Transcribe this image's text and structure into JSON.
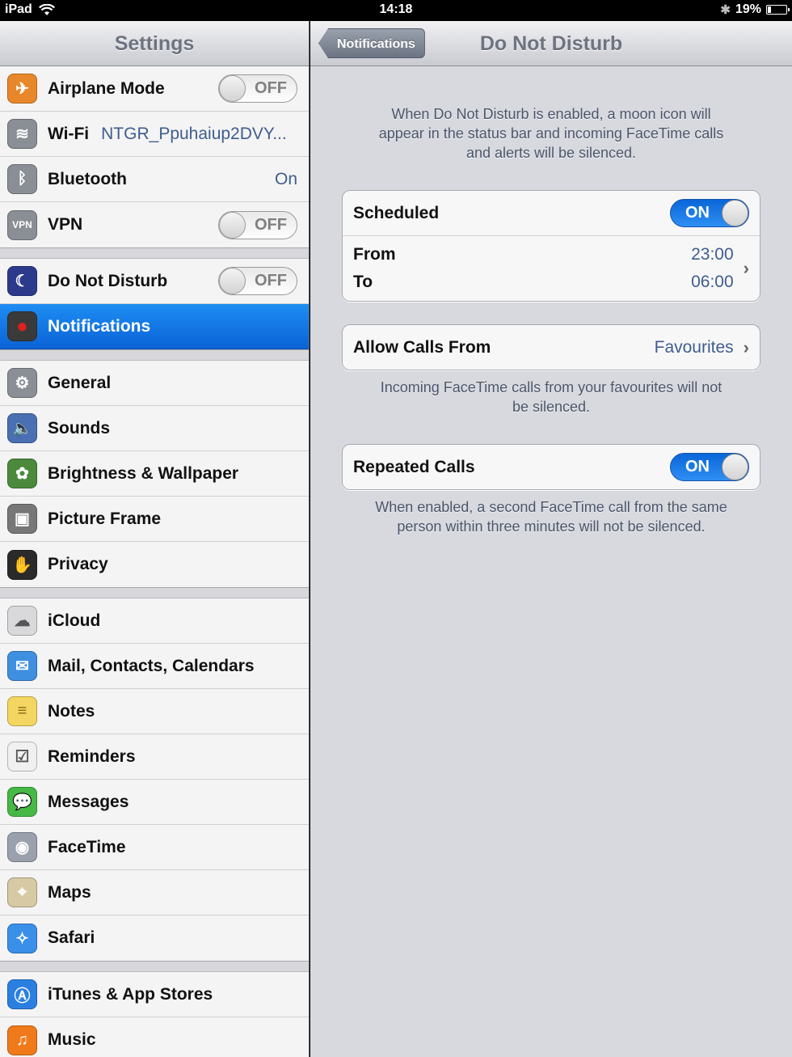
{
  "status_bar": {
    "device": "iPad",
    "time": "14:18",
    "battery_text": "19%",
    "battery_level": 0.19
  },
  "sidebar": {
    "title": "Settings",
    "groups": [
      [
        {
          "label": "Airplane Mode",
          "icon": "airplane-icon",
          "color": "#e8872a",
          "switch": "OFF"
        },
        {
          "label": "Wi-Fi",
          "icon": "wifi-icon",
          "color": "#8a8e95",
          "value": "NTGR_Ppuhaiup2DVY..."
        },
        {
          "label": "Bluetooth",
          "icon": "bluetooth-icon",
          "color": "#8a8e95",
          "value": "On"
        },
        {
          "label": "VPN",
          "icon": "vpn-icon",
          "color": "#8a8e95",
          "switch": "OFF"
        }
      ],
      [
        {
          "label": "Do Not Disturb",
          "icon": "moon-icon",
          "color": "#2c3a8c",
          "switch": "OFF"
        },
        {
          "label": "Notifications",
          "icon": "notifications-icon",
          "color": "#3a3a3a",
          "selected": true
        }
      ],
      [
        {
          "label": "General",
          "icon": "gear-icon",
          "color": "#8a8e95"
        },
        {
          "label": "Sounds",
          "icon": "speaker-icon",
          "color": "#4a6fb3"
        },
        {
          "label": "Brightness & Wallpaper",
          "icon": "flower-icon",
          "color": "#4b8a3c"
        },
        {
          "label": "Picture Frame",
          "icon": "picture-frame-icon",
          "color": "#777"
        },
        {
          "label": "Privacy",
          "icon": "hand-icon",
          "color": "#2a2a2a"
        }
      ],
      [
        {
          "label": "iCloud",
          "icon": "cloud-icon",
          "color": "#d9d9dc"
        },
        {
          "label": "Mail, Contacts, Calendars",
          "icon": "mail-icon",
          "color": "#3f8fe0"
        },
        {
          "label": "Notes",
          "icon": "notes-icon",
          "color": "#f3d661"
        },
        {
          "label": "Reminders",
          "icon": "reminders-icon",
          "color": "#f0f0f0"
        },
        {
          "label": "Messages",
          "icon": "messages-icon",
          "color": "#45b845"
        },
        {
          "label": "FaceTime",
          "icon": "facetime-icon",
          "color": "#9aa1ad"
        },
        {
          "label": "Maps",
          "icon": "maps-icon",
          "color": "#d7c9a3"
        },
        {
          "label": "Safari",
          "icon": "safari-icon",
          "color": "#3a8fe8"
        }
      ],
      [
        {
          "label": "iTunes & App Stores",
          "icon": "app-store-icon",
          "color": "#2b7fe0"
        },
        {
          "label": "Music",
          "icon": "music-icon",
          "color": "#f07a1a"
        }
      ]
    ]
  },
  "detail": {
    "back_label": "Notifications",
    "title": "Do Not Disturb",
    "intro": "When Do Not Disturb is enabled, a moon icon will appear in the status bar and incoming FaceTime calls and alerts will be silenced.",
    "scheduled_label": "Scheduled",
    "scheduled_switch": "ON",
    "from_label": "From",
    "from_value": "23:00",
    "to_label": "To",
    "to_value": "06:00",
    "allow_calls_label": "Allow Calls From",
    "allow_calls_value": "Favourites",
    "allow_calls_note": "Incoming FaceTime calls from your favourites will not be silenced.",
    "repeated_label": "Repeated Calls",
    "repeated_switch": "ON",
    "repeated_note": "When enabled, a second FaceTime call from the same person within three minutes will not be silenced."
  }
}
